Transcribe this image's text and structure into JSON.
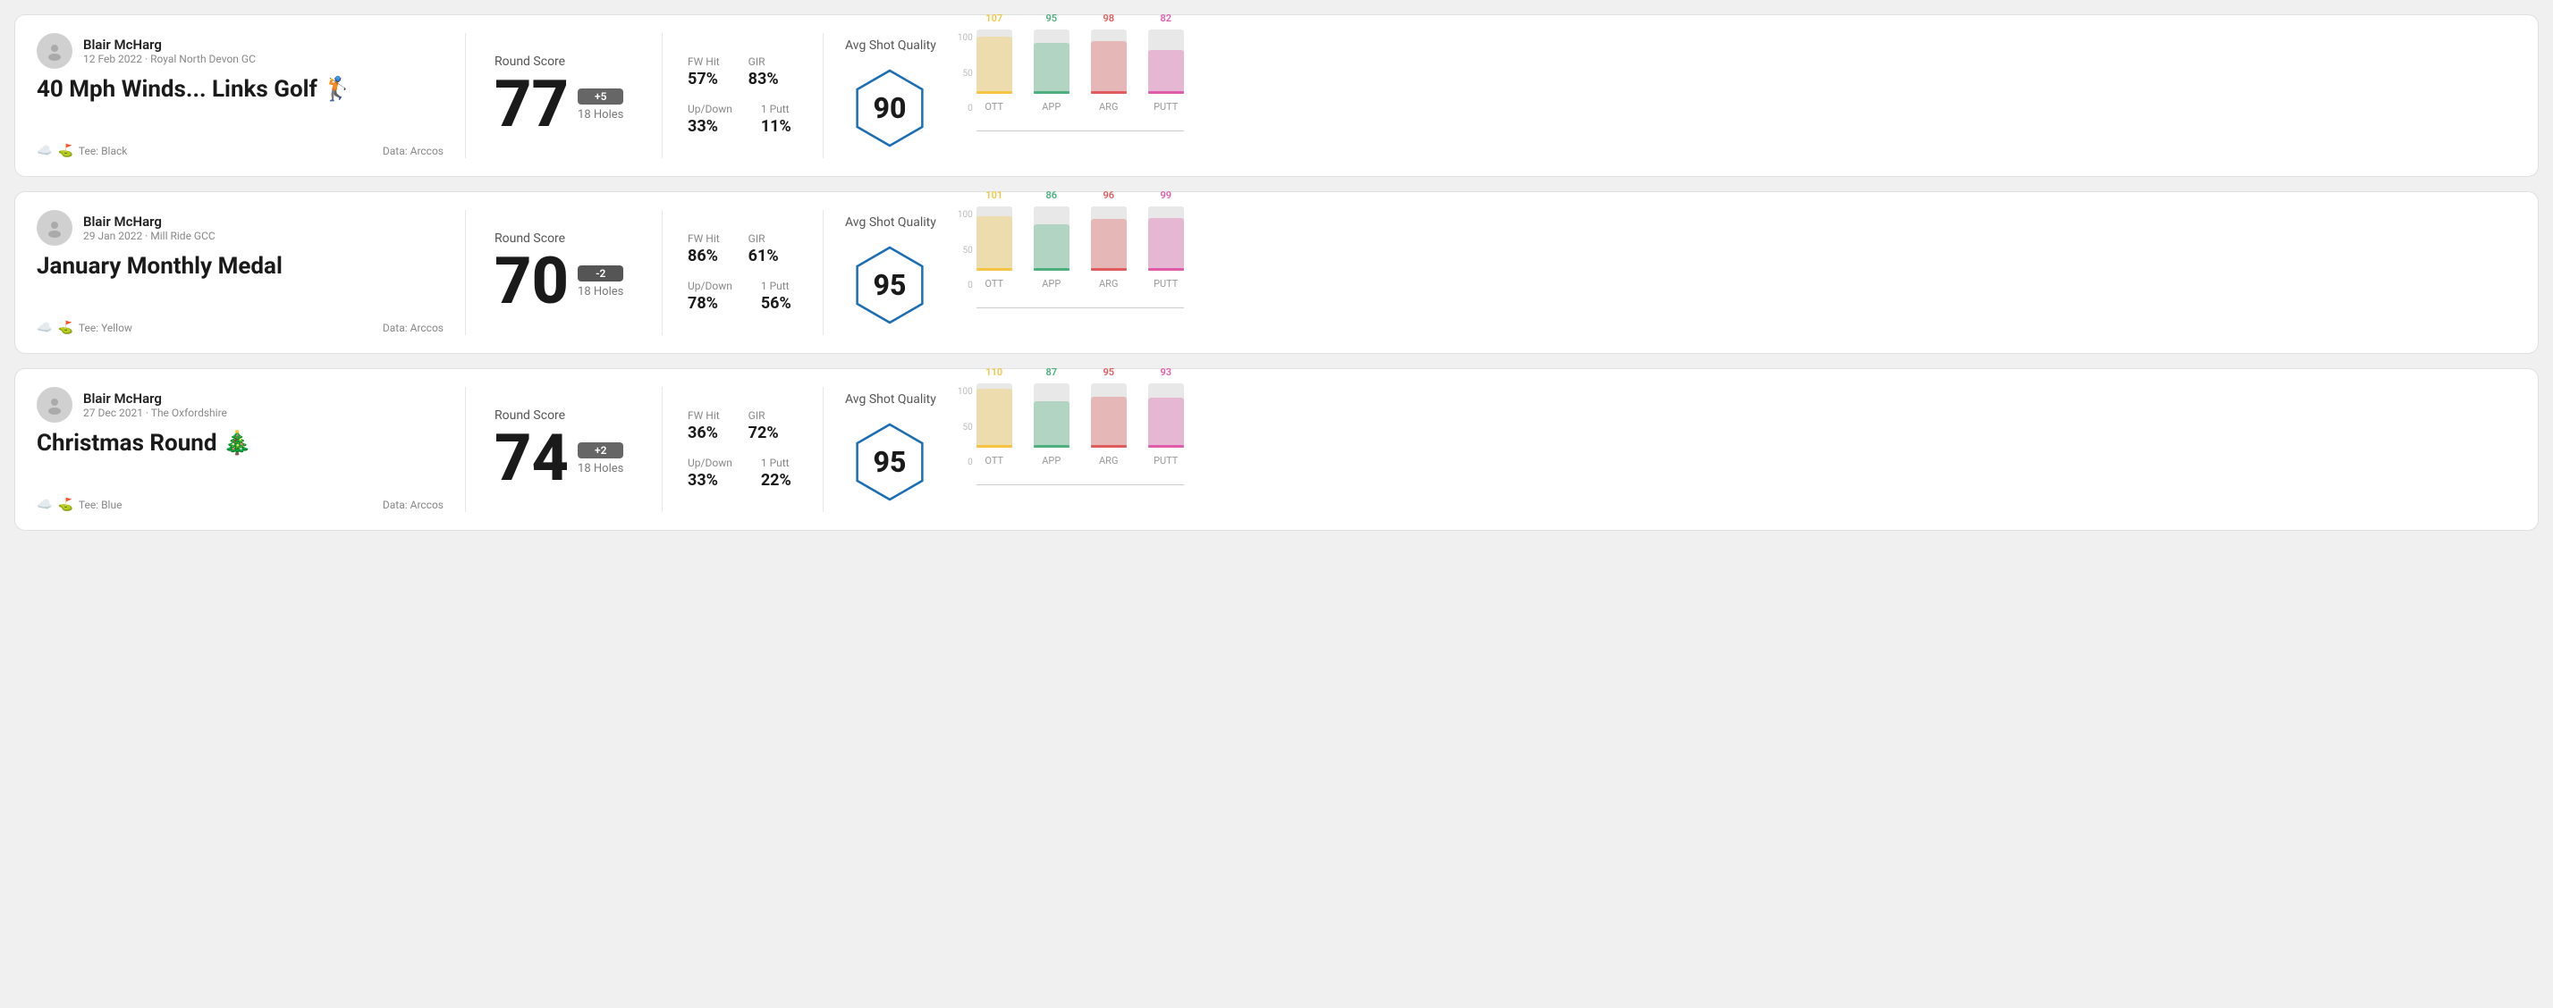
{
  "rounds": [
    {
      "id": "round1",
      "player": {
        "name": "Blair McHarg",
        "date": "12 Feb 2022 · Royal North Devon GC"
      },
      "title": "40 Mph Winds... Links Golf",
      "title_emoji": "🏌️",
      "tee": "Black",
      "data_source": "Data: Arccos",
      "score": {
        "label": "Round Score",
        "number": "77",
        "badge": "+5",
        "badge_type": "positive",
        "holes": "18 Holes"
      },
      "stats": {
        "fw_hit_label": "FW Hit",
        "fw_hit_value": "57%",
        "gir_label": "GIR",
        "gir_value": "83%",
        "updown_label": "Up/Down",
        "updown_value": "33%",
        "oneputt_label": "1 Putt",
        "oneputt_value": "11%"
      },
      "quality": {
        "label": "Avg Shot Quality",
        "score": "90"
      },
      "chart": {
        "bars": [
          {
            "label": "OTT",
            "value": 107,
            "color": "#f5c542",
            "max": 120
          },
          {
            "label": "APP",
            "value": 95,
            "color": "#4caf7d",
            "max": 120
          },
          {
            "label": "ARG",
            "value": 98,
            "color": "#e05c5c",
            "max": 120
          },
          {
            "label": "PUTT",
            "value": 82,
            "color": "#e05caa",
            "max": 120
          }
        ],
        "y_labels": [
          "100",
          "50",
          "0"
        ]
      }
    },
    {
      "id": "round2",
      "player": {
        "name": "Blair McHarg",
        "date": "29 Jan 2022 · Mill Ride GCC"
      },
      "title": "January Monthly Medal",
      "title_emoji": "",
      "tee": "Yellow",
      "data_source": "Data: Arccos",
      "score": {
        "label": "Round Score",
        "number": "70",
        "badge": "-2",
        "badge_type": "negative",
        "holes": "18 Holes"
      },
      "stats": {
        "fw_hit_label": "FW Hit",
        "fw_hit_value": "86%",
        "gir_label": "GIR",
        "gir_value": "61%",
        "updown_label": "Up/Down",
        "updown_value": "78%",
        "oneputt_label": "1 Putt",
        "oneputt_value": "56%"
      },
      "quality": {
        "label": "Avg Shot Quality",
        "score": "95"
      },
      "chart": {
        "bars": [
          {
            "label": "OTT",
            "value": 101,
            "color": "#f5c542",
            "max": 120
          },
          {
            "label": "APP",
            "value": 86,
            "color": "#4caf7d",
            "max": 120
          },
          {
            "label": "ARG",
            "value": 96,
            "color": "#e05c5c",
            "max": 120
          },
          {
            "label": "PUTT",
            "value": 99,
            "color": "#e05caa",
            "max": 120
          }
        ],
        "y_labels": [
          "100",
          "50",
          "0"
        ]
      }
    },
    {
      "id": "round3",
      "player": {
        "name": "Blair McHarg",
        "date": "27 Dec 2021 · The Oxfordshire"
      },
      "title": "Christmas Round",
      "title_emoji": "🎄",
      "tee": "Blue",
      "data_source": "Data: Arccos",
      "score": {
        "label": "Round Score",
        "number": "74",
        "badge": "+2",
        "badge_type": "positive",
        "holes": "18 Holes"
      },
      "stats": {
        "fw_hit_label": "FW Hit",
        "fw_hit_value": "36%",
        "gir_label": "GIR",
        "gir_value": "72%",
        "updown_label": "Up/Down",
        "updown_value": "33%",
        "oneputt_label": "1 Putt",
        "oneputt_value": "22%"
      },
      "quality": {
        "label": "Avg Shot Quality",
        "score": "95"
      },
      "chart": {
        "bars": [
          {
            "label": "OTT",
            "value": 110,
            "color": "#f5c542",
            "max": 120
          },
          {
            "label": "APP",
            "value": 87,
            "color": "#4caf7d",
            "max": 120
          },
          {
            "label": "ARG",
            "value": 95,
            "color": "#e05c5c",
            "max": 120
          },
          {
            "label": "PUTT",
            "value": 93,
            "color": "#e05caa",
            "max": 120
          }
        ],
        "y_labels": [
          "100",
          "50",
          "0"
        ]
      }
    }
  ]
}
